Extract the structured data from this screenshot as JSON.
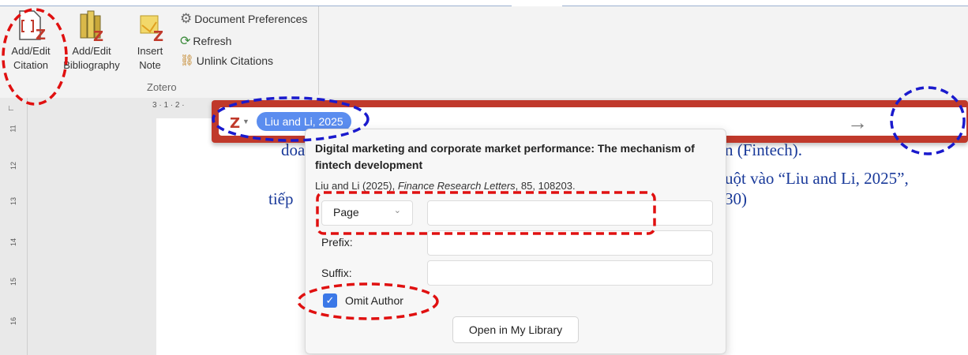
{
  "ribbon": {
    "add_edit_citation": "Add/Edit Citation",
    "add_edit_bibliography": "Add/Edit Bibliography",
    "insert_note": "Insert Note",
    "document_preferences": "Document Preferences",
    "refresh": "Refresh",
    "unlink_citations": "Unlink Citations",
    "group_label": "Zotero"
  },
  "ruler": {
    "horizontal_text": "3 · 1 · 2 ·",
    "vertical_ticks": [
      "11",
      "12",
      "13",
      "14",
      "15",
      "16"
    ]
  },
  "document": {
    "line1_prefix": "doa",
    "line1_suffix": "n (Fintech).",
    "line2_suffix": "uột vào  “Liu and Li, 2025”,",
    "line3_prefix": "tiếp",
    "line3_suffix": "30)"
  },
  "citation_bar": {
    "chip_label": "Liu and Li, 2025",
    "accent_color": "#c0392b",
    "chip_color": "#5b8def",
    "submit_icon": "arrow-right-icon"
  },
  "item_popup": {
    "title": "Digital marketing and corporate market performance: The mechanism of fintech development",
    "citation_prefix": "Liu and Li (2025),",
    "journal": "Finance Research Letters",
    "citation_suffix": ", 85, 108203.",
    "locator_type": "Page",
    "locator_value": "",
    "prefix_label": "Prefix:",
    "prefix_value": "",
    "suffix_label": "Suffix:",
    "suffix_value": "",
    "omit_author_label": "Omit Author",
    "omit_author_checked": true,
    "open_library_button": "Open in My Library"
  },
  "annotations": {
    "red_color": "#e01010",
    "blue_color": "#1a1acd"
  }
}
